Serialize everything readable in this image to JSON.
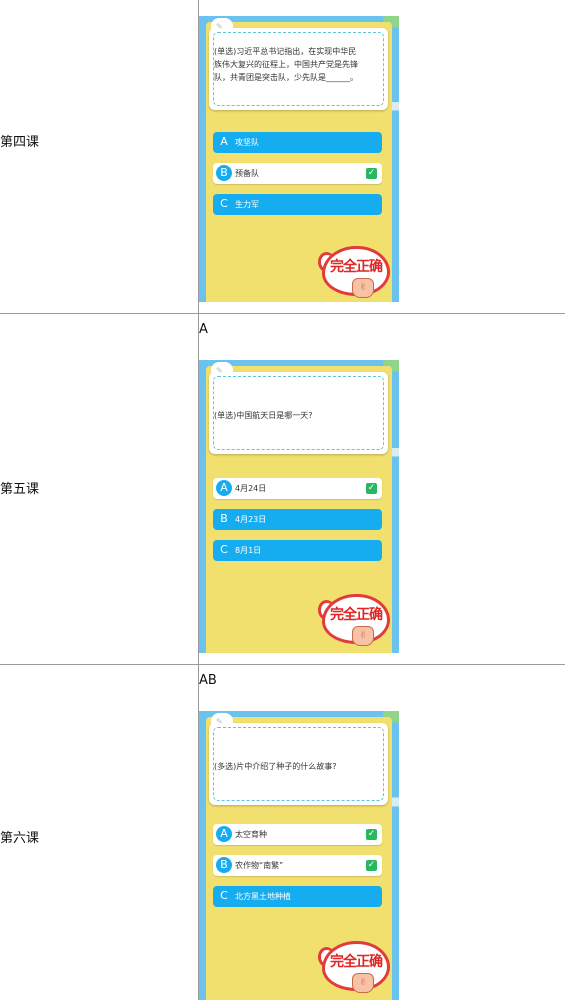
{
  "rows": [
    {
      "lesson": "第四课",
      "answer": "",
      "question": [
        "(单选)习近平总书记指出，在实现中华民",
        "族伟大复兴的征程上，中国共产党是先锋",
        "队，共青团是突击队，少先队是______。"
      ],
      "options": [
        {
          "letter": "A",
          "text": "攻坚队",
          "selected": false
        },
        {
          "letter": "B",
          "text": "预备队",
          "selected": true
        },
        {
          "letter": "C",
          "text": "生力军",
          "selected": false
        }
      ],
      "stamp": "完全正确"
    },
    {
      "lesson": "第五课",
      "answer": "A",
      "question": [
        "(单选)中国航天日是哪一天?"
      ],
      "options": [
        {
          "letter": "A",
          "text": "4月24日",
          "selected": true
        },
        {
          "letter": "B",
          "text": "4月23日",
          "selected": false
        },
        {
          "letter": "C",
          "text": "8月1日",
          "selected": false
        }
      ],
      "stamp": "完全正确"
    },
    {
      "lesson": "第六课",
      "answer": "AB",
      "question": [
        "(多选)片中介绍了种子的什么故事?"
      ],
      "options": [
        {
          "letter": "A",
          "text": "太空育种",
          "selected": true
        },
        {
          "letter": "B",
          "text": "农作物“南繁”",
          "selected": true
        },
        {
          "letter": "C",
          "text": "北方黑土地种植",
          "selected": false
        }
      ],
      "stamp": "完全正确"
    }
  ],
  "colors": {
    "option_blue": "#16adf0",
    "card_yellow": "#f2e06e",
    "check_green": "#28b65e",
    "stamp_red": "#e02525"
  }
}
